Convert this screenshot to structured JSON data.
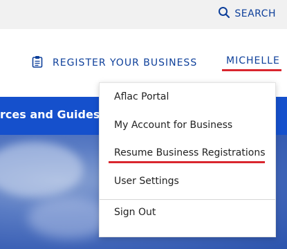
{
  "header": {
    "search_label": "SEARCH",
    "search_icon": "search-icon"
  },
  "nav": {
    "register_label": "REGISTER YOUR BUSINESS",
    "register_icon": "clipboard-icon",
    "user_label": "MICHELLE"
  },
  "banner": {
    "text": "rces and Guides"
  },
  "dropdown": {
    "items": [
      {
        "label": "Aflac Portal"
      },
      {
        "label": "My Account for Business"
      },
      {
        "label": "Resume Business Registrations"
      },
      {
        "label": "User Settings"
      },
      {
        "label": "Sign Out"
      }
    ]
  },
  "colors": {
    "link_blue": "#0d3f9a",
    "banner_blue": "#1550cc",
    "annotation_red": "#d9262e"
  }
}
